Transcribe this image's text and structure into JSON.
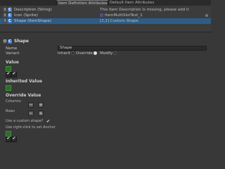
{
  "tabs": {
    "active": "Item Definition Attributes",
    "inactive": "Default Item Attributes"
  },
  "attributes": [
    {
      "icons": [
        "I",
        "C"
      ],
      "name": "Description (String)",
      "value": "This Item Description is missing, please add it"
    },
    {
      "icons": [
        "I",
        "C"
      ],
      "name": "Icon (Sprite)",
      "value": "ItemMultiSlotTest_1"
    },
    {
      "icons": [
        "I",
        "C"
      ],
      "name": "Shape (ItemShape)",
      "value": "[2,2] Custom Shape"
    }
  ],
  "header": {
    "icons": [
      "O",
      "C"
    ],
    "title": "Shape"
  },
  "name_label": "Name",
  "name_value": "Shape",
  "variant_label": "Variant",
  "variant_options": [
    "Inherit",
    "Override",
    "Modify"
  ],
  "variant_selected": "Modify",
  "value_section": "Value",
  "inherited_section": "Inherited Value",
  "override_section": "Override Value",
  "columns_label": "Columns",
  "rows_label": "Rows",
  "minus": "−",
  "plus": "+",
  "custom_shape_label": "Use a custom shape?",
  "custom_shape_checked": true,
  "right_click_label": "Use right-click to set Anchor",
  "checkmark": "✔",
  "colors": {
    "selected_row": "#2c5d87",
    "cell_on": "#2a6b2a",
    "icon_blue": "#3a79c4"
  }
}
